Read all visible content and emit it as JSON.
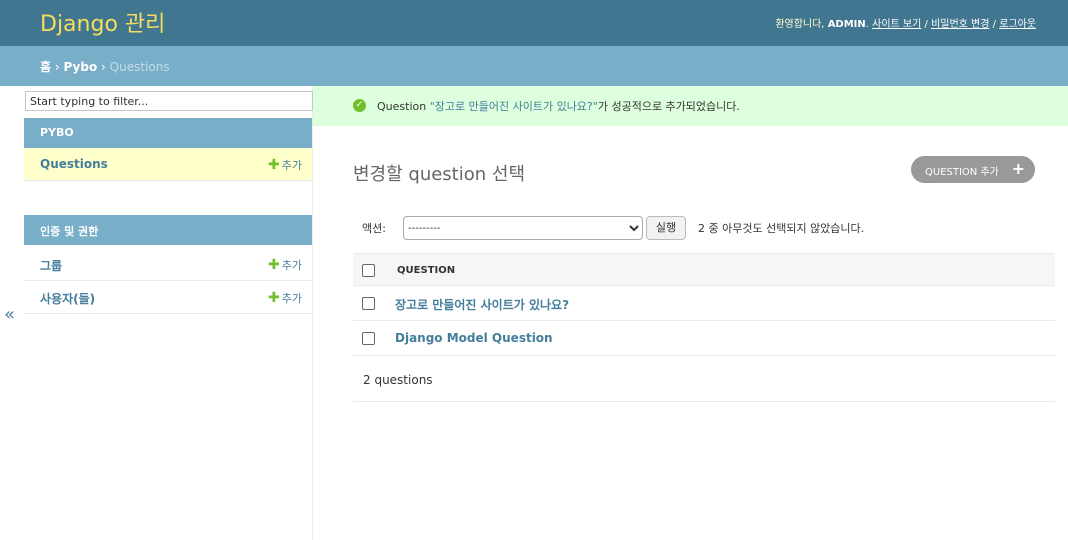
{
  "header": {
    "brand": "Django 관리",
    "welcome": "환영합니다,",
    "user": "ADMIN",
    "links": [
      "사이트 보기",
      "비밀번호 변경",
      "로그아웃"
    ]
  },
  "breadcrumbs": {
    "home": "홈",
    "app": "Pybo",
    "current": "Questions"
  },
  "sidebar": {
    "toggle": "«",
    "filter_placeholder": "Start typing to filter...",
    "modules": [
      {
        "title": "PYBO",
        "items": [
          {
            "label": "Questions",
            "add": "추가"
          }
        ]
      },
      {
        "title": "인증 및 권한",
        "items": [
          {
            "label": "그룹",
            "add": "추가"
          },
          {
            "label": "사용자(들)",
            "add": "추가"
          }
        ]
      }
    ]
  },
  "message": {
    "prefix": "Question ",
    "object": "\"장고로 만들어진 사이트가 있나요?\"",
    "suffix": "가 성공적으로 추가되었습니다."
  },
  "content": {
    "title": "변경할 question 선택",
    "add_button": "QUESTION 추가",
    "actions_label": "액션:",
    "action_selected": "---------",
    "go_button": "실행",
    "selection_count": "2 중 아무것도 선택되지 않았습니다.",
    "column_header": "QUESTION",
    "rows": [
      "장고로 만들어진 사이트가 있나요?",
      "Django Model Question"
    ],
    "paginator": "2 questions"
  },
  "colors": {
    "header": "#417690",
    "breadcrumbs": "#79aec8",
    "brand": "#f5dd5d",
    "link": "#447e9b",
    "success_bg": "#dfd",
    "add_icon": "#70bf2b"
  }
}
